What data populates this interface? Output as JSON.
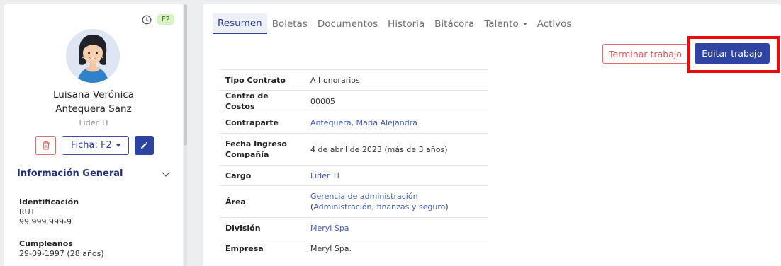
{
  "profile": {
    "badge": "F2",
    "name_line1": "Luisana Verónica",
    "name_line2": "Antequera Sanz",
    "role": "Lider TI",
    "ficha_label": "Ficha: F2",
    "section_title": "Información General",
    "fields": [
      {
        "label": "Identificación",
        "line1": "RUT",
        "line2": "99.999.999-9"
      },
      {
        "label": "Cumpleaños",
        "line1": "29-09-1997 (28 años)"
      }
    ]
  },
  "tabs": [
    {
      "label": "Resumen",
      "active": true
    },
    {
      "label": "Boletas"
    },
    {
      "label": "Documentos"
    },
    {
      "label": "Historia"
    },
    {
      "label": "Bitácora"
    },
    {
      "label": "Talento",
      "dropdown": true
    },
    {
      "label": "Activos"
    }
  ],
  "buttons": {
    "terminar": "Terminar trabajo",
    "editar": "Editar trabajo"
  },
  "details": [
    {
      "key": "Tipo Contrato",
      "value": "A honorarios"
    },
    {
      "key": "Centro de Costos",
      "value": "00005"
    },
    {
      "key": "Contraparte",
      "value": "Antequera, María Alejandra",
      "link": true
    },
    {
      "key": "Fecha Ingreso Compañía",
      "value": "4 de abril de 2023 (más de 3 años)"
    },
    {
      "key": "Cargo",
      "value": "Lider TI",
      "link": true
    },
    {
      "key": "Área",
      "value_part1": "Gerencia de administración",
      "value_part2": " (",
      "value_part3": "Administración, finanzas y seguro",
      "value_part4": ")"
    },
    {
      "key": "División",
      "value": "Meryl Spa",
      "link": true
    },
    {
      "key": "Empresa",
      "value": "Meryl Spa."
    }
  ],
  "colors": {
    "primary": "#2f43a3",
    "danger": "#e56b6b",
    "highlight": "#ef0a0a",
    "badge_bg": "#d6f5c3"
  }
}
